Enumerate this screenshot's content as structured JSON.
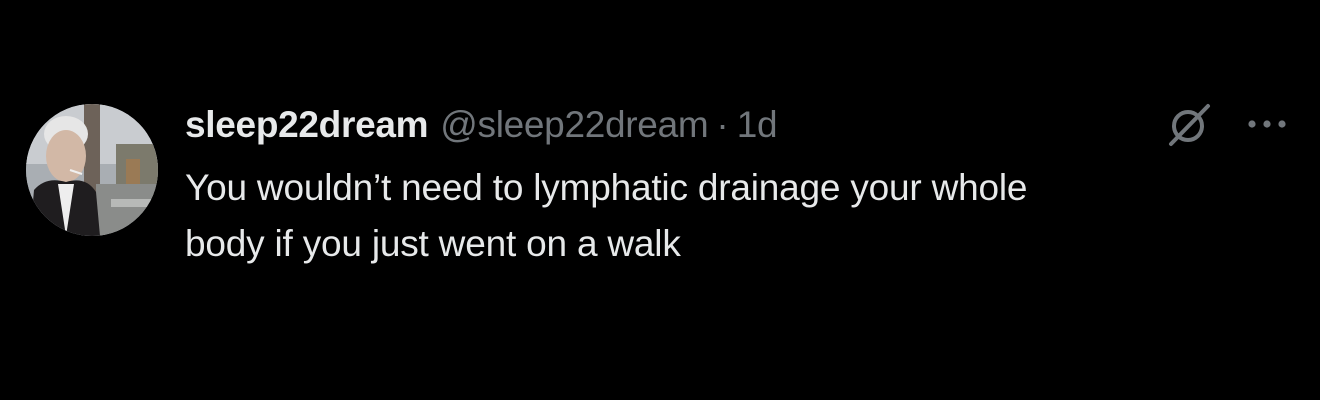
{
  "tweet": {
    "display_name": "sleep22dream",
    "handle": "@sleep22dream",
    "separator": "·",
    "time": "1d",
    "text_line1": "You wouldn’t need to lymphatic drainage your whole",
    "text_line2": "body if you just went on a walk"
  },
  "icons": {
    "avatar": "profile-photo",
    "grok": "grok-slash-circle-icon",
    "more": "more-horizontal-icon"
  },
  "colors": {
    "background": "#000000",
    "primary_text": "#e7e9ea",
    "secondary_text": "#71767b"
  }
}
